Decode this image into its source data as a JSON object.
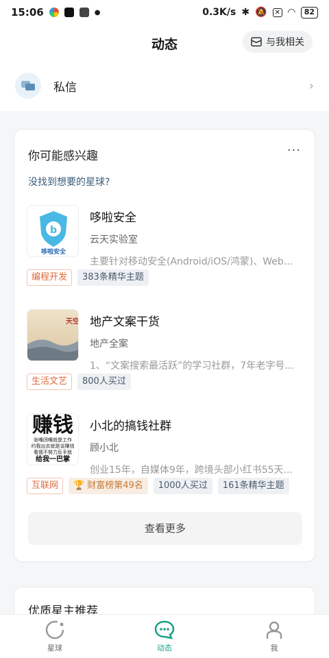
{
  "status_bar": {
    "time": "15:06",
    "network_speed": "0.3K/s",
    "battery": "82"
  },
  "header": {
    "title": "动态",
    "related_label": "与我相关"
  },
  "dm": {
    "label": "私信"
  },
  "interest": {
    "title": "你可能感兴趣",
    "more": "···",
    "subtitle": "没找到想要的星球?",
    "items": [
      {
        "name": "哆啦安全",
        "owner": "云天实验室",
        "desc": "主要针对移动安全(Android/iOS/鸿蒙)、Web...",
        "thumb_text": "哆啦安全",
        "tags": [
          "编程开发",
          "383条精华主题"
        ]
      },
      {
        "name": "地产文案干货",
        "owner": "地产全案",
        "desc": "1、“文案搜索最活跃”的学习社群，7年老字号...",
        "thumb_text": "天空",
        "tags": [
          "生活文艺",
          "800人买过"
        ]
      },
      {
        "name": "小北的搞钱社群",
        "owner": "顾小北",
        "desc": "创业15年，自媒体9年，跨境头部小红书55天...",
        "thumb_title": "赚钱",
        "thumb_lines": [
          "张嘴闭嘴就是工作",
          "约我出去就是谈赚钱",
          "看我不努力反手就",
          "给我一巴掌"
        ],
        "tags": [
          "互联网",
          "财富榜第49名",
          "1000人买过",
          "161条精华主题"
        ]
      }
    ],
    "view_more": "查看更多"
  },
  "recommend": {
    "title": "优质星主推荐"
  },
  "nav": [
    {
      "label": "星球",
      "icon": "planet-icon"
    },
    {
      "label": "动态",
      "icon": "chat-bubble-icon"
    },
    {
      "label": "我",
      "icon": "person-icon"
    }
  ],
  "colors": {
    "accent": "#16a085",
    "tag_orange": "#e06a3c",
    "subtitle_blue": "#3b5d7a"
  }
}
